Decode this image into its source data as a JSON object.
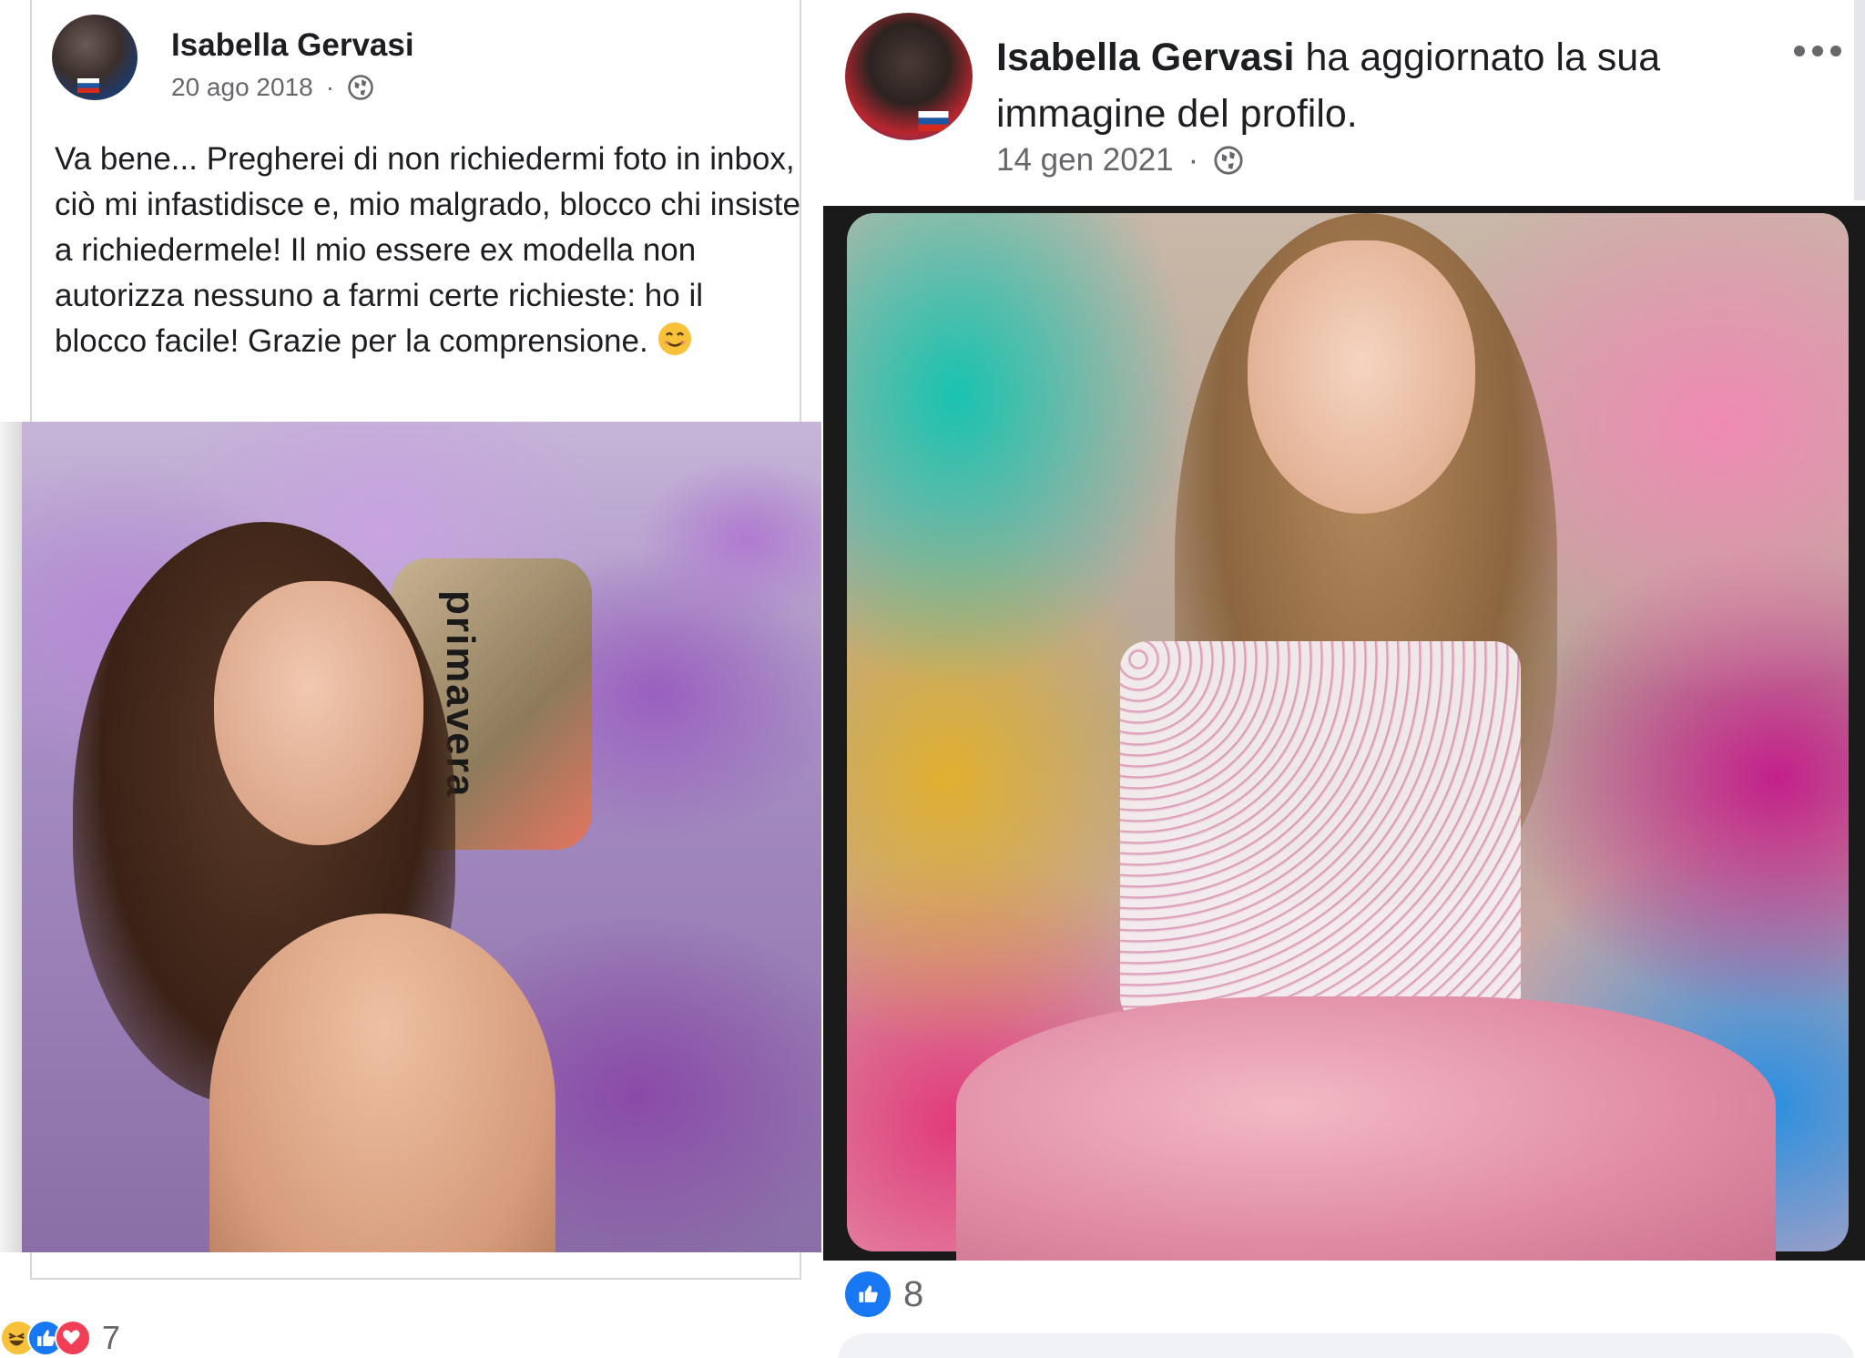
{
  "left_post": {
    "author": "Isabella Gervasi",
    "date": "20 ago 2018",
    "separator": "·",
    "privacy_icon": "globe-icon",
    "text": "Va bene... Pregherei di non richiedermi foto in inbox, ciò mi infastidisce e, mio malgrado, blocco chi insiste a richiedermele! Il mio essere ex modella non autorizza nessuno a farmi certe richieste: ho il blocco facile! Grazie per la comprensione.",
    "emoji": "smiling-face-icon",
    "photo_caption_text": "primavera",
    "reaction_icons": [
      "haha-icon",
      "like-icon",
      "love-icon"
    ],
    "reaction_count": "7"
  },
  "right_post": {
    "author": "Isabella Gervasi",
    "action": "ha aggiornato la sua immagine del profilo.",
    "date": "14 gen 2021",
    "separator": "·",
    "privacy_icon": "globe-icon",
    "more_icon": "more-options-icon",
    "reaction_icons": [
      "like-icon"
    ],
    "reaction_count": "8"
  },
  "colors": {
    "facebook_blue": "#1877f2",
    "meta_gray": "#65676b",
    "text_dark": "#1c1e21",
    "love_red": "#f33e58",
    "haha_yellow": "#f7c13a"
  }
}
